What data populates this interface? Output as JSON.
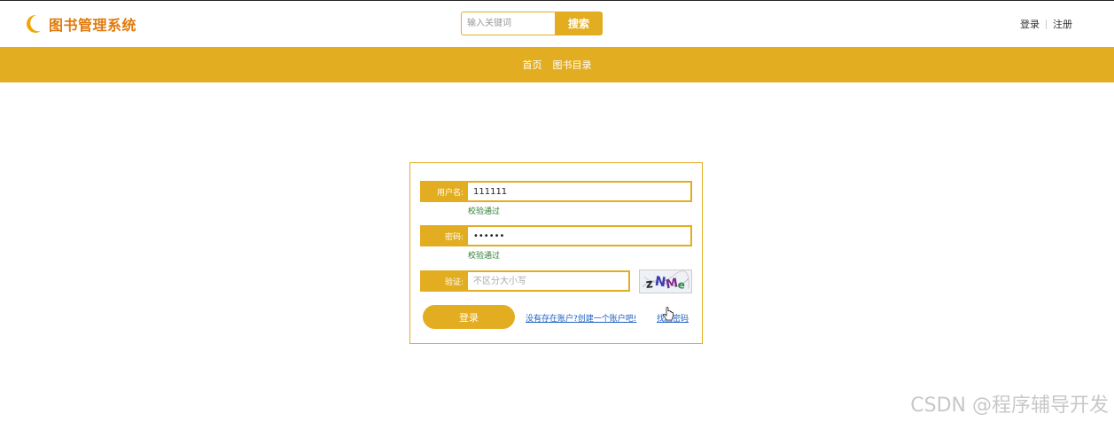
{
  "header": {
    "logo_icon": "crescent-moon-icon",
    "title": "图书管理系统",
    "search": {
      "placeholder": "输入关键词",
      "button": "搜索"
    },
    "auth": {
      "login": "登录",
      "register": "注册"
    }
  },
  "nav": {
    "items": [
      {
        "label": "首页"
      },
      {
        "label": "图书目录"
      }
    ]
  },
  "login_form": {
    "username": {
      "label": "用户名:",
      "value": "111111",
      "hint": "校验通过"
    },
    "password": {
      "label": "密码:",
      "value": "111111",
      "hint": "校验通过"
    },
    "captcha": {
      "label": "验证:",
      "placeholder": "不区分大小写",
      "image_text": "zNMe"
    },
    "submit": "登录",
    "register_link": "没有存在账户?创建一个账户吧!",
    "forgot_link": "找回密码"
  },
  "watermark": "CSDN @程序辅导开发",
  "colors": {
    "accent": "#e3ad21",
    "logo": "#e07a0c",
    "link": "#1e5fc0",
    "hint": "#2e7d32"
  }
}
